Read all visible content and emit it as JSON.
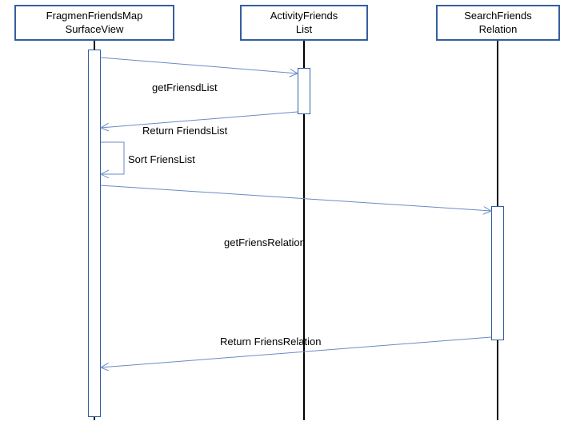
{
  "participants": {
    "p1": {
      "line1": "FragmenFriendsMap",
      "line2": "SurfaceView"
    },
    "p2": {
      "line1": "ActivityFriends",
      "line2": "List"
    },
    "p3": {
      "line1": "SearchFriends",
      "line2": "Relation"
    }
  },
  "messages": {
    "m1": "getFriensdList",
    "m2": "Return FriendsList",
    "m3": "Sort FriensList",
    "m4": "getFriensRelation",
    "m5": "Return FriensRelation"
  },
  "colors": {
    "border": "#345f9f",
    "line": "#000000",
    "arrow": "#6a8bc4"
  }
}
